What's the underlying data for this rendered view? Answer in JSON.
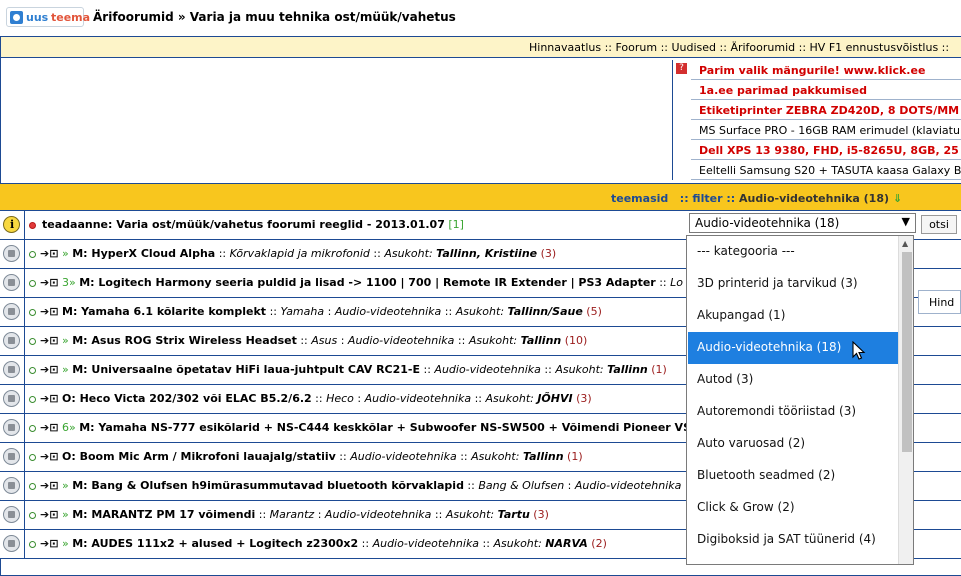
{
  "header": {
    "logo_uus": "uus",
    "logo_teema": "teema",
    "breadcrumb": "Ärifoorumid » Varia ja muu tehnika ost/müük/vahetus"
  },
  "topnav": "Hinnavaatlus :: Foorum :: Uudised :: Ärifoorumid :: HV F1 ennustusvõistlus ::",
  "ads": [
    {
      "text": "Parim valik mängurile! www.klick.ee",
      "red": true
    },
    {
      "text": "1a.ee parimad pakkumised",
      "red": true
    },
    {
      "text": "Etiketiprinter ZEBRA ZD420D, 8 DOTS/MM",
      "red": true
    },
    {
      "text": "MS Surface PRO - 16GB RAM erimudel (klaviatu",
      "red": false
    },
    {
      "text": "Dell XPS 13 9380, FHD, i5-8265U, 8GB, 25",
      "red": true
    },
    {
      "text": "Eeltelli Samsung S20 + TASUTA kaasa Galaxy B",
      "red": false
    }
  ],
  "filterbar": {
    "teemasid": "teemasid",
    "filter": ":: filter ::",
    "current": "Audio-videotehnika (18)"
  },
  "search_button": "otsi",
  "hind_label": "Hind",
  "dropdown": {
    "selected": "Audio-videotehnika (18)",
    "options": [
      "--- kategooria ---",
      "3D printerid ja tarvikud (3)",
      "Akupangad (1)",
      "Audio-videotehnika (18)",
      "Autod (3)",
      "Autoremondi tööriistad (3)",
      "Auto varuosad (2)",
      "Bluetooth seadmed (2)",
      "Click & Grow (2)",
      "Digiboksid ja SAT tüünerid (4)"
    ],
    "selected_index": 3
  },
  "topics": [
    {
      "pre": "",
      "title": "teadaanne: Varia ost/müük/vahetus foorumi reeglid - 2013.01.07",
      "brand": "",
      "location": "",
      "count": "[1]",
      "type": "info"
    },
    {
      "pre": "»",
      "title": "M: HyperX Cloud Alpha",
      "brand": "Kõrvaklapid ja mikrofonid",
      "location": "Tallinn, Kristiine",
      "count": "(3)"
    },
    {
      "pre": "3»",
      "title": "M: Logitech Harmony seeria puldid ja lisad -> 1100 | 700 | Remote IR Extender | PS3 Adapter",
      "brand": "Lo",
      "location": "",
      "count": ""
    },
    {
      "pre": "",
      "title": "M: Yamaha 6.1 kõlarite komplekt",
      "brand": "Yamaha",
      "location": "Tallinn/Saue",
      "count": "(5)"
    },
    {
      "pre": "»",
      "title": "M: Asus ROG Strix Wireless Headset",
      "brand": "Asus",
      "location": "Tallinn",
      "count": "(10)"
    },
    {
      "pre": "»",
      "title": "M: Universaalne õpetatav HiFi laua-juhtpult CAV RC21-E",
      "brand": "",
      "location": "Tallinn",
      "count": "(1)"
    },
    {
      "pre": "",
      "title": "O: Heco Victa 202/302 või ELAC B5.2/6.2",
      "brand": "Heco",
      "location": "JÕHVI",
      "count": "(3)"
    },
    {
      "pre": "6»",
      "title": "M: Yamaha NS-777 esikõlarid + NS-C444 keskkõlar + Subwoofer NS-SW500 + Võimendi Pioneer VS",
      "brand": "",
      "location": "",
      "count": ""
    },
    {
      "pre": "",
      "title": "O: Boom Mic Arm / Mikrofoni lauajalg/statiiv",
      "brand": "",
      "location": "Tallinn",
      "count": "(1)"
    },
    {
      "pre": "»",
      "title": "M: Bang & Olufsen h9imürasummutavad bluetooth kõrvaklapid",
      "brand": "Bang & Olufsen",
      "location": "",
      "count": ""
    },
    {
      "pre": "»",
      "title": "M: MARANTZ PM 17 võimendi",
      "brand": "Marantz",
      "location": "Tartu",
      "count": "(3)"
    },
    {
      "pre": "»",
      "title": "M: AUDES 111x2 + alused + Logitech z2300x2",
      "brand": "",
      "location": "NARVA",
      "count": "(2)"
    }
  ],
  "labels": {
    "category": "Audio-videotehnika",
    "location_prefix": "Asukoht:"
  }
}
